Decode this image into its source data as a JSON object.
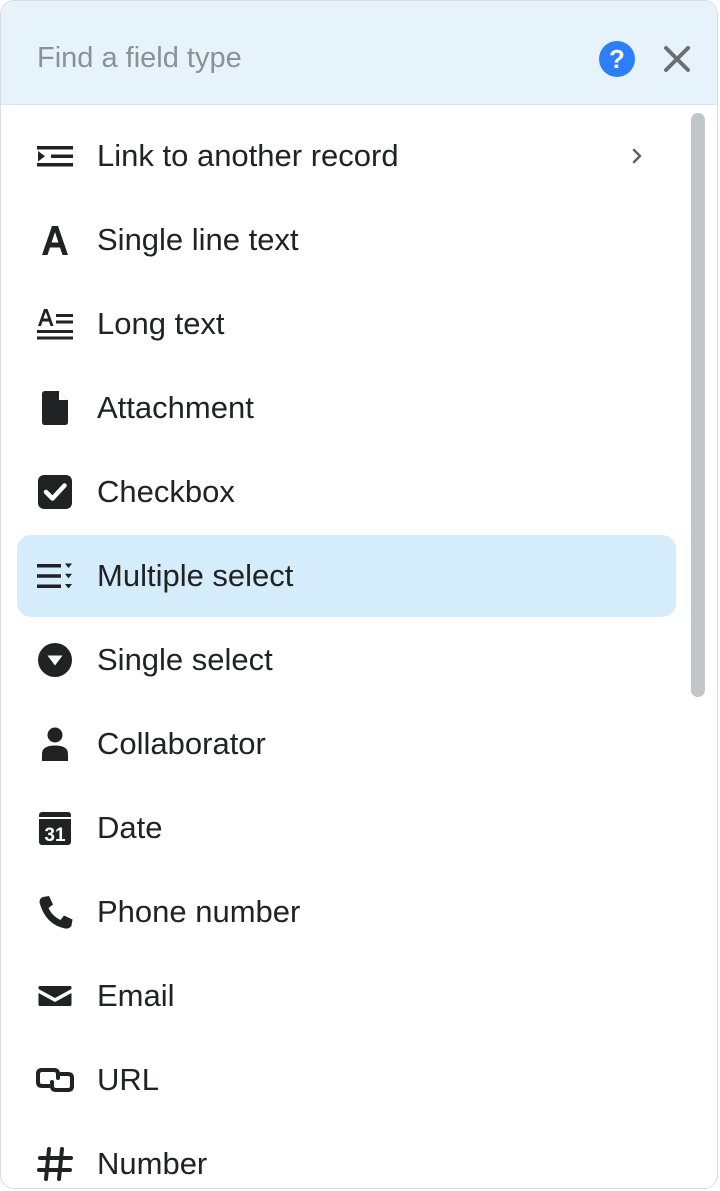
{
  "search": {
    "placeholder": "Find a field type",
    "value": ""
  },
  "icons": {
    "help": "question-circle-icon",
    "close": "close-icon"
  },
  "colors": {
    "header_bg": "#e6f3fb",
    "selected_bg": "#d5ecfa",
    "help_blue": "#2d7ff9",
    "text": "#202224"
  },
  "field_types": [
    {
      "label": "Link to another record",
      "icon": "link-record-icon",
      "has_submenu": true
    },
    {
      "label": "Single line text",
      "icon": "single-line-text-icon"
    },
    {
      "label": "Long text",
      "icon": "long-text-icon"
    },
    {
      "label": "Attachment",
      "icon": "attachment-icon"
    },
    {
      "label": "Checkbox",
      "icon": "checkbox-icon"
    },
    {
      "label": "Multiple select",
      "icon": "multiple-select-icon",
      "selected": true
    },
    {
      "label": "Single select",
      "icon": "single-select-icon"
    },
    {
      "label": "Collaborator",
      "icon": "collaborator-icon"
    },
    {
      "label": "Date",
      "icon": "date-icon",
      "icon_text": "31"
    },
    {
      "label": "Phone number",
      "icon": "phone-icon"
    },
    {
      "label": "Email",
      "icon": "email-icon"
    },
    {
      "label": "URL",
      "icon": "url-icon"
    },
    {
      "label": "Number",
      "icon": "number-icon"
    }
  ]
}
